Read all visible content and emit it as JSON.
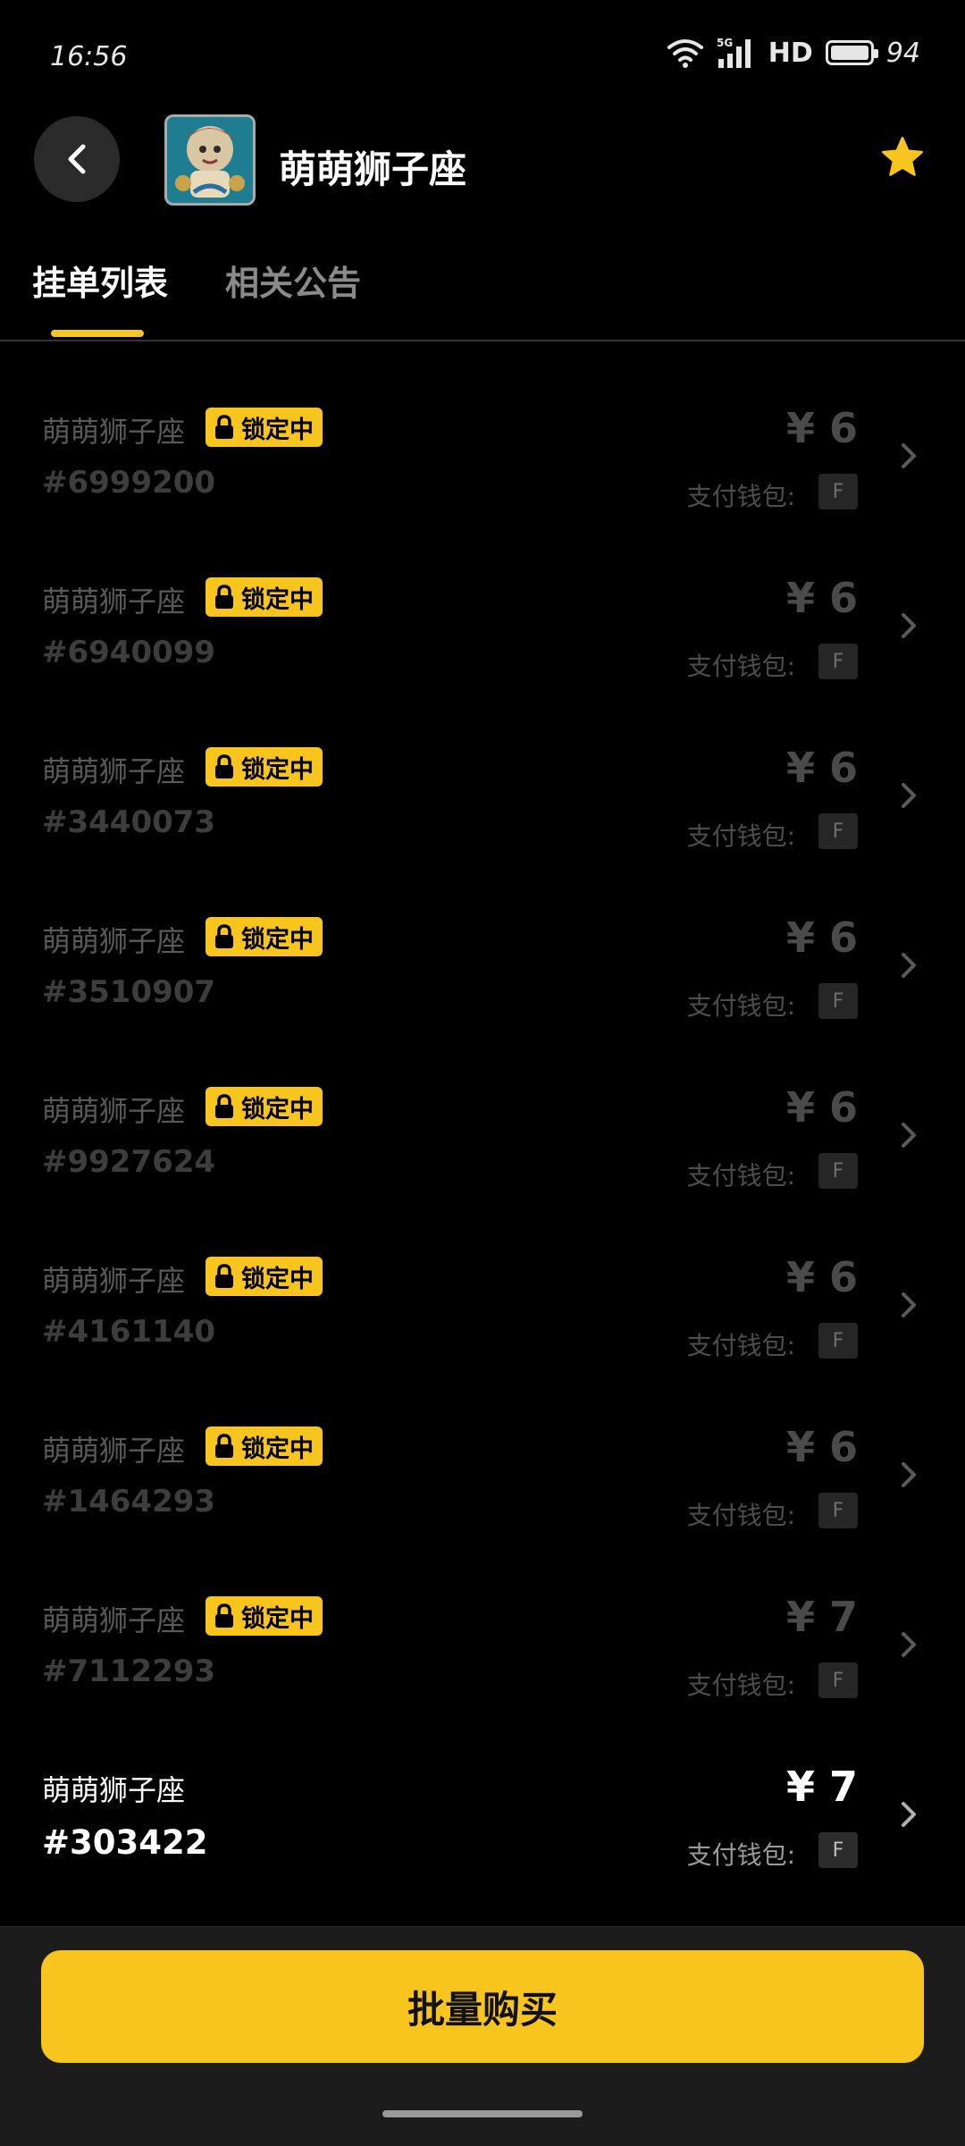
{
  "status_bar": {
    "time": "16:56",
    "network": "5G",
    "hd": "HD",
    "battery": "94"
  },
  "header": {
    "title": "萌萌狮子座"
  },
  "tabs": [
    {
      "label": "挂单列表",
      "active": true
    },
    {
      "label": "相关公告",
      "active": false
    }
  ],
  "lock_label": "锁定中",
  "wallet_label": "支付钱包:",
  "wallet_badge": "F",
  "listings": [
    {
      "name": "萌萌狮子座",
      "id": "#6999200",
      "price": "¥ 6",
      "locked": true
    },
    {
      "name": "萌萌狮子座",
      "id": "#6940099",
      "price": "¥ 6",
      "locked": true
    },
    {
      "name": "萌萌狮子座",
      "id": "#3440073",
      "price": "¥ 6",
      "locked": true
    },
    {
      "name": "萌萌狮子座",
      "id": "#3510907",
      "price": "¥ 6",
      "locked": true
    },
    {
      "name": "萌萌狮子座",
      "id": "#9927624",
      "price": "¥ 6",
      "locked": true
    },
    {
      "name": "萌萌狮子座",
      "id": "#4161140",
      "price": "¥ 6",
      "locked": true
    },
    {
      "name": "萌萌狮子座",
      "id": "#1464293",
      "price": "¥ 6",
      "locked": true
    },
    {
      "name": "萌萌狮子座",
      "id": "#7112293",
      "price": "¥ 7",
      "locked": true
    },
    {
      "name": "萌萌狮子座",
      "id": "#303422",
      "price": "¥ 7",
      "locked": false
    }
  ],
  "footer": {
    "bulk_buy_label": "批量购买"
  },
  "colors": {
    "accent": "#f7c51e",
    "background": "#000000"
  }
}
